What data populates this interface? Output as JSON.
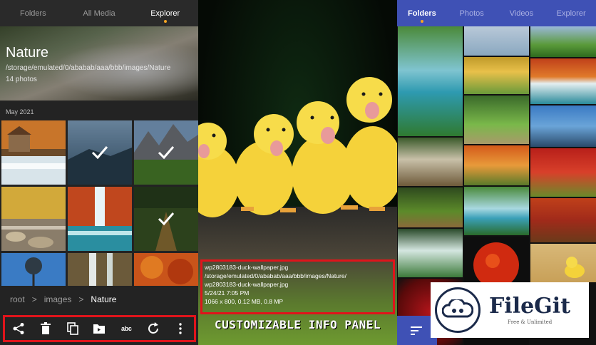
{
  "left": {
    "tabs": [
      {
        "label": "Folders",
        "active": false
      },
      {
        "label": "All Media",
        "active": false
      },
      {
        "label": "Explorer",
        "active": true
      }
    ],
    "album": {
      "title": "Nature",
      "path": "/storage/emulated/0/ababab/aaa/bbb/images/Nature",
      "count": "14 photos"
    },
    "month_header": "May 2021",
    "thumbnails": [
      {
        "subject": "watermill-autumn",
        "selected": false
      },
      {
        "subject": "blue-lake-mist",
        "selected": true
      },
      {
        "subject": "mountain-meadow",
        "selected": true
      },
      {
        "subject": "autumn-stream-rocks",
        "selected": false
      },
      {
        "subject": "waterfall-autumn-trees",
        "selected": false
      },
      {
        "subject": "forest-path",
        "selected": true
      },
      {
        "subject": "blue-sky-tree",
        "selected": false
      },
      {
        "subject": "waterfall-forest",
        "selected": false
      },
      {
        "subject": "autumn-foliage",
        "selected": false
      }
    ],
    "breadcrumb": {
      "items": [
        "root",
        "images"
      ],
      "separator": ">",
      "current": "Nature"
    },
    "toolbar": {
      "actions": [
        "share-icon",
        "delete-icon",
        "copy-icon",
        "move-icon",
        "rename-icon",
        "rotate-icon",
        "more-icon"
      ],
      "rename_label": "abc"
    }
  },
  "middle": {
    "info_panel": {
      "line1": "wp2803183-duck-wallpaper.jpg",
      "line2": "/storage/emulated/0/ababab/aaa/bbb/images/Nature/",
      "line3": "wp2803183-duck-wallpaper.jpg",
      "line4": "5/24/21 7:05 PM",
      "line5": "1066 x 800, 0.12 MB, 0.8 MP"
    },
    "caption": "CUSTOMIZABLE INFO PANEL"
  },
  "right": {
    "tabs": [
      {
        "label": "Folders",
        "active": true
      },
      {
        "label": "Photos",
        "active": false
      },
      {
        "label": "Videos",
        "active": false
      },
      {
        "label": "Explorer",
        "active": false
      }
    ]
  },
  "watermark": {
    "name": "FileGit",
    "tagline": "Free & Unlimited"
  },
  "colors": {
    "left_bg": "#232323",
    "right_tab_bar": "#3f51b5",
    "highlight_border": "#e0141b",
    "active_dot": "#f5a623"
  }
}
